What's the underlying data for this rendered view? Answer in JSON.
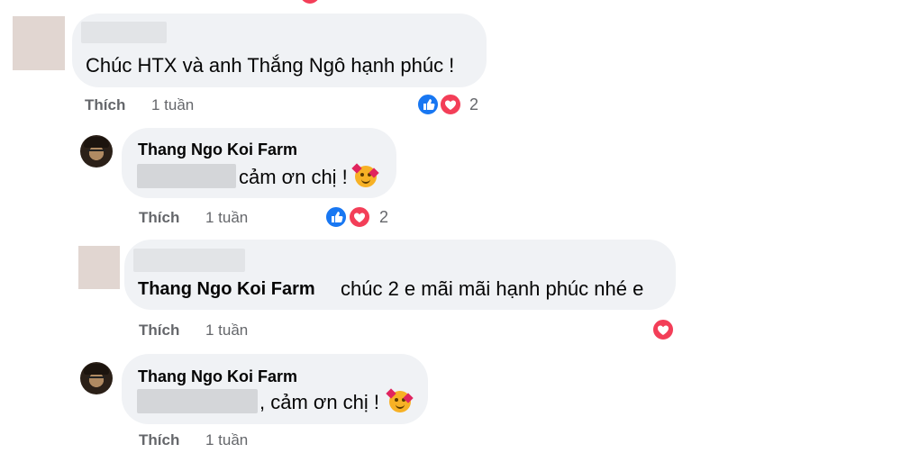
{
  "comments": [
    {
      "author_visible": false,
      "text": "Chúc HTX và anh Thắng Ngô hạnh phúc !",
      "action_label": "Thích",
      "time": "1 tuần",
      "reactions": [
        "like-icon",
        "love-icon"
      ],
      "reaction_count": "2"
    },
    {
      "author": "Thang Ngo Koi Farm",
      "text": "cảm ơn chị !",
      "action_label": "Thích",
      "time": "1 tuần",
      "reactions": [
        "like-icon",
        "love-icon"
      ],
      "reaction_count": "2"
    },
    {
      "author_visible": false,
      "tagged": "Thang Ngo Koi Farm",
      "text": "chúc 2 e mãi mãi hạnh phúc nhé e",
      "action_label": "Thích",
      "time": "1 tuần",
      "reactions": [
        "love-icon"
      ]
    },
    {
      "author": "Thang Ngo Koi Farm",
      "text": ", cảm ơn chị !",
      "action_label": "Thích",
      "time": "1 tuần"
    }
  ],
  "colors": {
    "bubble": "#f0f2f5",
    "meta_text": "#65676b",
    "like": "#1877f2",
    "love": "#f33e58"
  }
}
